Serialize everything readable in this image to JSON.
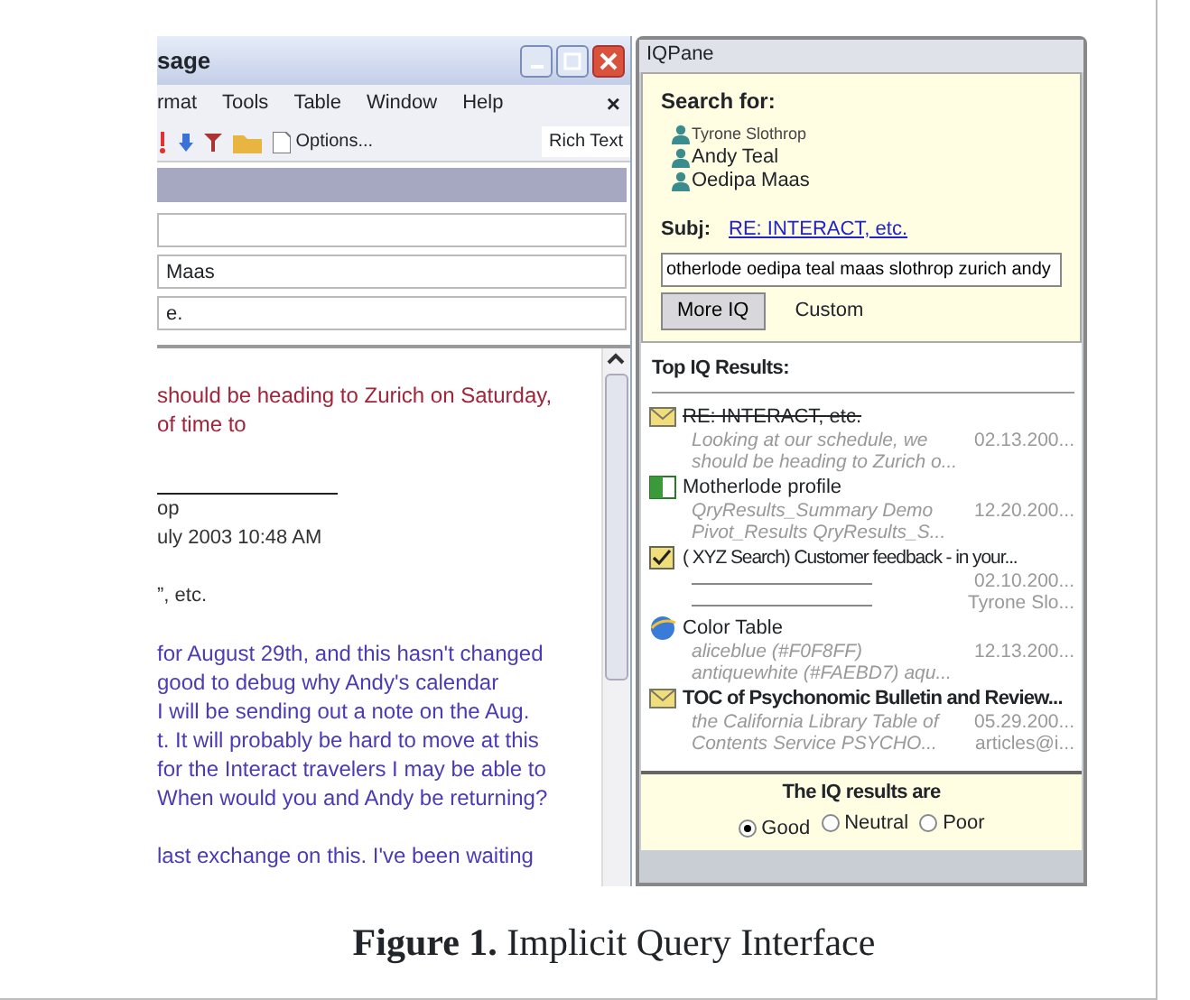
{
  "email_window": {
    "title": "sage",
    "menu": [
      "rmat",
      "Tools",
      "Table",
      "Window",
      "Help"
    ],
    "close_doc": "×",
    "toolbar": {
      "options": "Options...",
      "format": "Rich Text"
    },
    "fields": [
      {
        "value": "Maas"
      },
      {
        "value": "e."
      }
    ],
    "body": [
      {
        "kind": "red",
        "text": "should be heading to Zurich on Saturday,"
      },
      {
        "kind": "red",
        "text": "of time to"
      },
      {
        "kind": "gap"
      },
      {
        "kind": "rule"
      },
      {
        "kind": "header",
        "text": "op"
      },
      {
        "kind": "header",
        "text": "uly 2003 10:48 AM"
      },
      {
        "kind": "gap"
      },
      {
        "kind": "header",
        "text": "”, etc."
      },
      {
        "kind": "gap"
      },
      {
        "kind": "blue",
        "text": "for August 29th, and this hasn't changed"
      },
      {
        "kind": "blue",
        "text": "good to debug why Andy's calendar"
      },
      {
        "kind": "blue",
        "text": "I will be sending out a note on the Aug."
      },
      {
        "kind": "blue",
        "text": "t. It will probably be hard to move at this"
      },
      {
        "kind": "blue",
        "text": "for the Interact travelers I may be able to"
      },
      {
        "kind": "blue",
        "text": "When would you and Andy be returning?"
      },
      {
        "kind": "gap"
      },
      {
        "kind": "blue",
        "text": "last exchange on this.  I've been waiting"
      }
    ]
  },
  "iq_pane": {
    "title": "IQPane",
    "search_label": "Search for:",
    "people": [
      {
        "name": "Tyrone Slothrop",
        "dimmed": true
      },
      {
        "name": "Andy Teal",
        "dimmed": false
      },
      {
        "name": "Oedipa Maas",
        "dimmed": false
      }
    ],
    "subj_label": "Subj:",
    "subj_link": "RE: INTERACT, etc.",
    "query": "otherlode oedipa teal maas slothrop zurich andy",
    "more_button": "More IQ",
    "custom_label": "Custom",
    "results_label": "Top IQ Results:",
    "results": [
      {
        "kind": "mail",
        "struck": true,
        "bold": false,
        "title": "RE: INTERACT, etc.",
        "lines": [
          {
            "kind": "text",
            "text": "Looking at our schedule, we",
            "side": "02.13.200..."
          },
          {
            "kind": "text",
            "text": "should be heading to Zurich o..."
          }
        ]
      },
      {
        "kind": "sheet",
        "struck": false,
        "bold": false,
        "title": "Motherlode profile",
        "lines": [
          {
            "kind": "text",
            "text": "QryResults_Summary  Demo",
            "side": "12.20.200..."
          },
          {
            "kind": "text",
            "text": "Pivot_Results  QryResults_S..."
          }
        ]
      },
      {
        "kind": "task",
        "struck": false,
        "bold": false,
        "title": "(  XYZ Search) Customer feedback - in your...",
        "lines": [
          {
            "kind": "rule",
            "side": "02.10.200..."
          },
          {
            "kind": "rule",
            "side": "Tyrone Slo..."
          }
        ]
      },
      {
        "kind": "web",
        "struck": false,
        "bold": false,
        "title": "Color Table",
        "lines": [
          {
            "kind": "text",
            "text": "aliceblue (#F0F8FF)",
            "side": "12.13.200..."
          },
          {
            "kind": "text",
            "text": "antiquewhite (#FAEBD7)  aqu..."
          }
        ]
      },
      {
        "kind": "mail",
        "struck": false,
        "bold": true,
        "title": "TOC of Psychonomic Bulletin and Review...",
        "lines": [
          {
            "kind": "text",
            "text": "the California Library Table of",
            "side": "05.29.200..."
          },
          {
            "kind": "text",
            "text": "Contents Service   PSYCHO...",
            "side": "articles@i..."
          }
        ]
      }
    ],
    "rating_label": "The IQ results are",
    "ratings": [
      {
        "label": "Good",
        "selected": true
      },
      {
        "label": "Neutral",
        "selected": false
      },
      {
        "label": "Poor",
        "selected": false
      }
    ]
  },
  "caption": "**Figure 1.**  Implicit Query Interface"
}
